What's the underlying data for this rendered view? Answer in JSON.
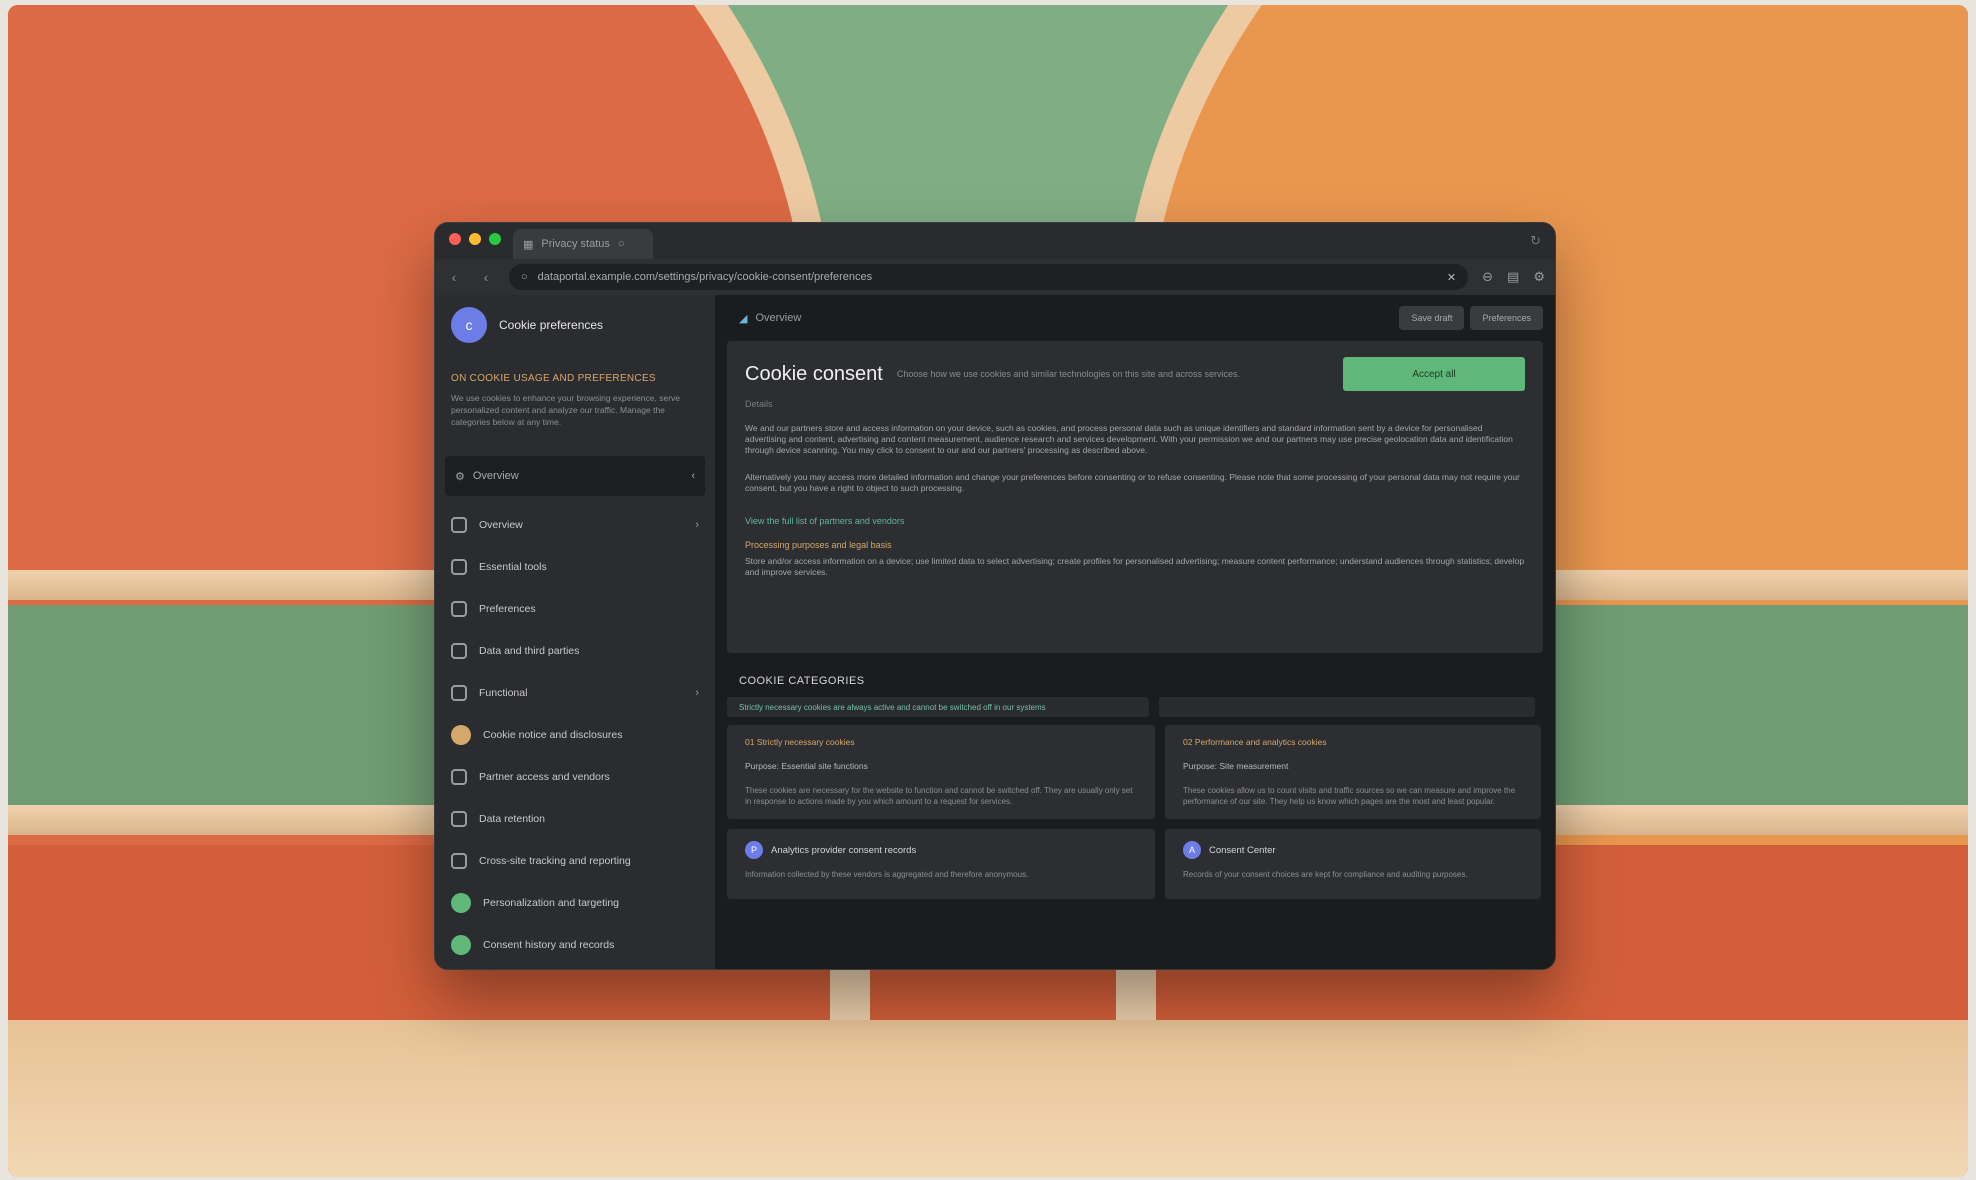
{
  "window": {
    "tab_title": "Privacy status",
    "url": "dataportal.example.com/settings/privacy/cookie-consent/preferences"
  },
  "sidebar": {
    "profile_name": "Cookie preferences",
    "notice_title": "ON COOKIE USAGE AND PREFERENCES",
    "notice_text": "We use cookies to enhance your browsing experience, serve personalized content and analyze our traffic. Manage the categories below at any time.",
    "section_label": "Overview",
    "items": [
      {
        "label": "Overview",
        "icon": "shield-icon",
        "arrow": "›"
      },
      {
        "label": "Essential tools",
        "icon": "square-icon",
        "arrow": ""
      },
      {
        "label": "Preferences",
        "icon": "square-icon",
        "arrow": ""
      },
      {
        "label": "Data and third parties",
        "icon": "database-icon",
        "arrow": ""
      },
      {
        "label": "Functional",
        "icon": "square-icon",
        "arrow": "›"
      },
      {
        "label": "Cookie notice and disclosures",
        "icon": "orange-dot-icon",
        "arrow": ""
      },
      {
        "label": "Partner access and vendors",
        "icon": "lock-icon",
        "arrow": ""
      },
      {
        "label": "Data retention",
        "icon": "archive-icon",
        "arrow": ""
      },
      {
        "label": "Cross-site tracking and reporting",
        "icon": "shield-icon",
        "arrow": ""
      },
      {
        "label": "Personalization and targeting",
        "icon": "green-dot-icon",
        "arrow": ""
      },
      {
        "label": "Consent history and records",
        "icon": "green-dot-icon",
        "arrow": ""
      }
    ]
  },
  "main": {
    "breadcrumb": "Overview",
    "btn_secondary": "Save draft",
    "btn_primary": "Preferences",
    "consent": {
      "title": "Cookie consent",
      "subtitle": "Choose how we use cookies and similar technologies on this site and across services.",
      "accept_label": "Accept all",
      "small": "Details",
      "para1": "We and our partners store and access information on your device, such as cookies, and process personal data such as unique identifiers and standard information sent by a device for personalised advertising and content, advertising and content measurement, audience research and services development. With your permission we and our partners may use precise geolocation data and identification through device scanning. You may click to consent to our and our partners' processing as described above.",
      "para2": "Alternatively you may access more detailed information and change your preferences before consenting or to refuse consenting. Please note that some processing of your personal data may not require your consent, but you have a right to object to such processing.",
      "link": "View the full list of partners and vendors",
      "subhead": "Processing purposes and legal basis",
      "list": "Store and/or access information on a device; use limited data to select advertising; create profiles for personalised advertising; measure content performance; understand audiences through statistics; develop and improve services."
    },
    "section_title": "COOKIE CATEGORIES",
    "filter_left": "Strictly necessary cookies are always active and cannot be switched off in our systems",
    "filter_right": "",
    "cards": [
      {
        "tag": "01  Strictly necessary cookies",
        "label": "Purpose: Essential site functions",
        "text": "These cookies are necessary for the website to function and cannot be switched off. They are usually only set in response to actions made by you which amount to a request for services."
      },
      {
        "tag": "02  Performance and analytics cookies",
        "label": "Purpose: Site measurement",
        "text": "These cookies allow us to count visits and traffic sources so we can measure and improve the performance of our site. They help us know which pages are the most and least popular."
      }
    ],
    "vendors": [
      {
        "initial": "P",
        "name": "Analytics provider consent records"
      },
      {
        "initial": "A",
        "name": "Consent Center"
      }
    ],
    "vendor_text": [
      "Information collected by these vendors is aggregated and therefore anonymous.",
      "Records of your consent choices are kept for compliance and auditing purposes."
    ]
  },
  "colors": {
    "accent_green": "#5fb879",
    "accent_orange": "#d4a86b",
    "avatar_blue": "#6d7de8"
  }
}
